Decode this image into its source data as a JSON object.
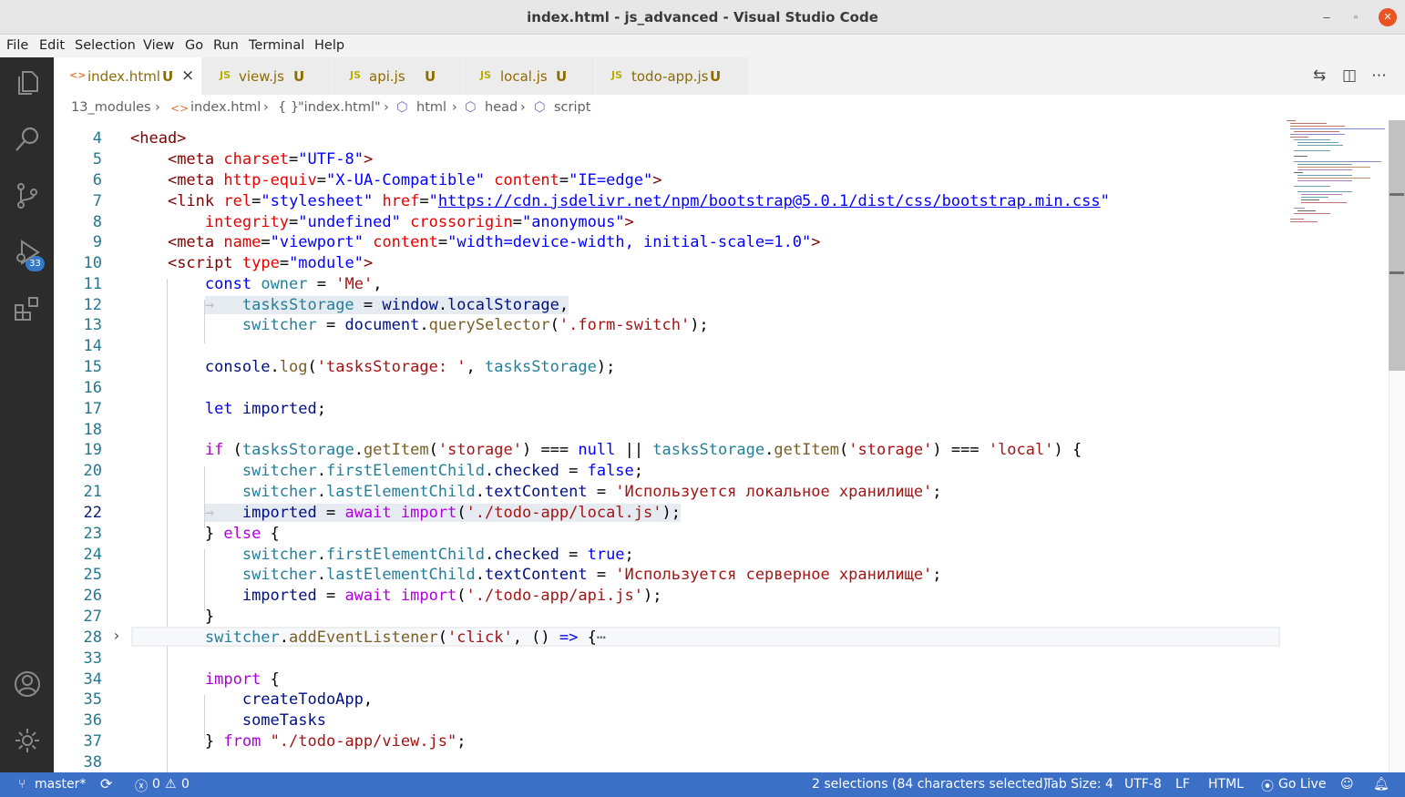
{
  "window": {
    "title": "index.html - js_advanced - Visual Studio Code",
    "minimize": "–",
    "maximize": "▫",
    "close": "✕"
  },
  "menu": [
    "File",
    "Edit",
    "Selection",
    "View",
    "Go",
    "Run",
    "Terminal",
    "Help"
  ],
  "activity_bar": {
    "items": [
      "explorer-icon",
      "search-icon",
      "source-control-icon",
      "run-debug-icon",
      "extensions-icon",
      "account-icon",
      "settings-gear-icon"
    ],
    "source_control_badge": "33"
  },
  "tabs": [
    {
      "icon": "<>",
      "label": "index.html",
      "status": "U",
      "close": "×"
    },
    {
      "icon": "JS",
      "label": "view.js",
      "status": "U"
    },
    {
      "icon": "JS",
      "label": "api.js",
      "status": "U"
    },
    {
      "icon": "JS",
      "label": "local.js",
      "status": "U"
    },
    {
      "icon": "JS",
      "label": "todo-app.js",
      "status": "U"
    }
  ],
  "breadcrumb": [
    {
      "label": "13_modules",
      "sep": "›"
    },
    {
      "icon": "<>",
      "label": "index.html",
      "sep": "›"
    },
    {
      "icon": "{ }",
      "label": "\"index.html\"",
      "sep": "›"
    },
    {
      "icon": "⬡",
      "label": "html",
      "sep": "›"
    },
    {
      "icon": "⬡",
      "label": "head",
      "sep": "›"
    },
    {
      "icon": "⬡",
      "label": "script"
    }
  ],
  "editor": {
    "line_numbers": [
      "4",
      "5",
      "6",
      "7",
      "8",
      "9",
      "10",
      "11",
      "12",
      "13",
      "14",
      "15",
      "16",
      "17",
      "18",
      "19",
      "20",
      "21",
      "22",
      "23",
      "24",
      "25",
      "26",
      "27",
      "28",
      "33",
      "34",
      "35",
      "36",
      "37",
      "38"
    ],
    "current_line": "22",
    "folded_line": "28"
  },
  "status_bar": {
    "branch": "master*",
    "sync": "⟳",
    "errors": "0",
    "warnings": "0",
    "selection": "2 selections (84 characters selected)",
    "tab_size": "Tab Size: 4",
    "encoding": "UTF-8",
    "eol": "LF",
    "language": "HTML",
    "go_live": "Go Live"
  },
  "colors": {
    "accent": "#3c70c7",
    "activity_bar": "#2c2c2c",
    "badge": "#3478c6",
    "close_button": "#e95420"
  }
}
